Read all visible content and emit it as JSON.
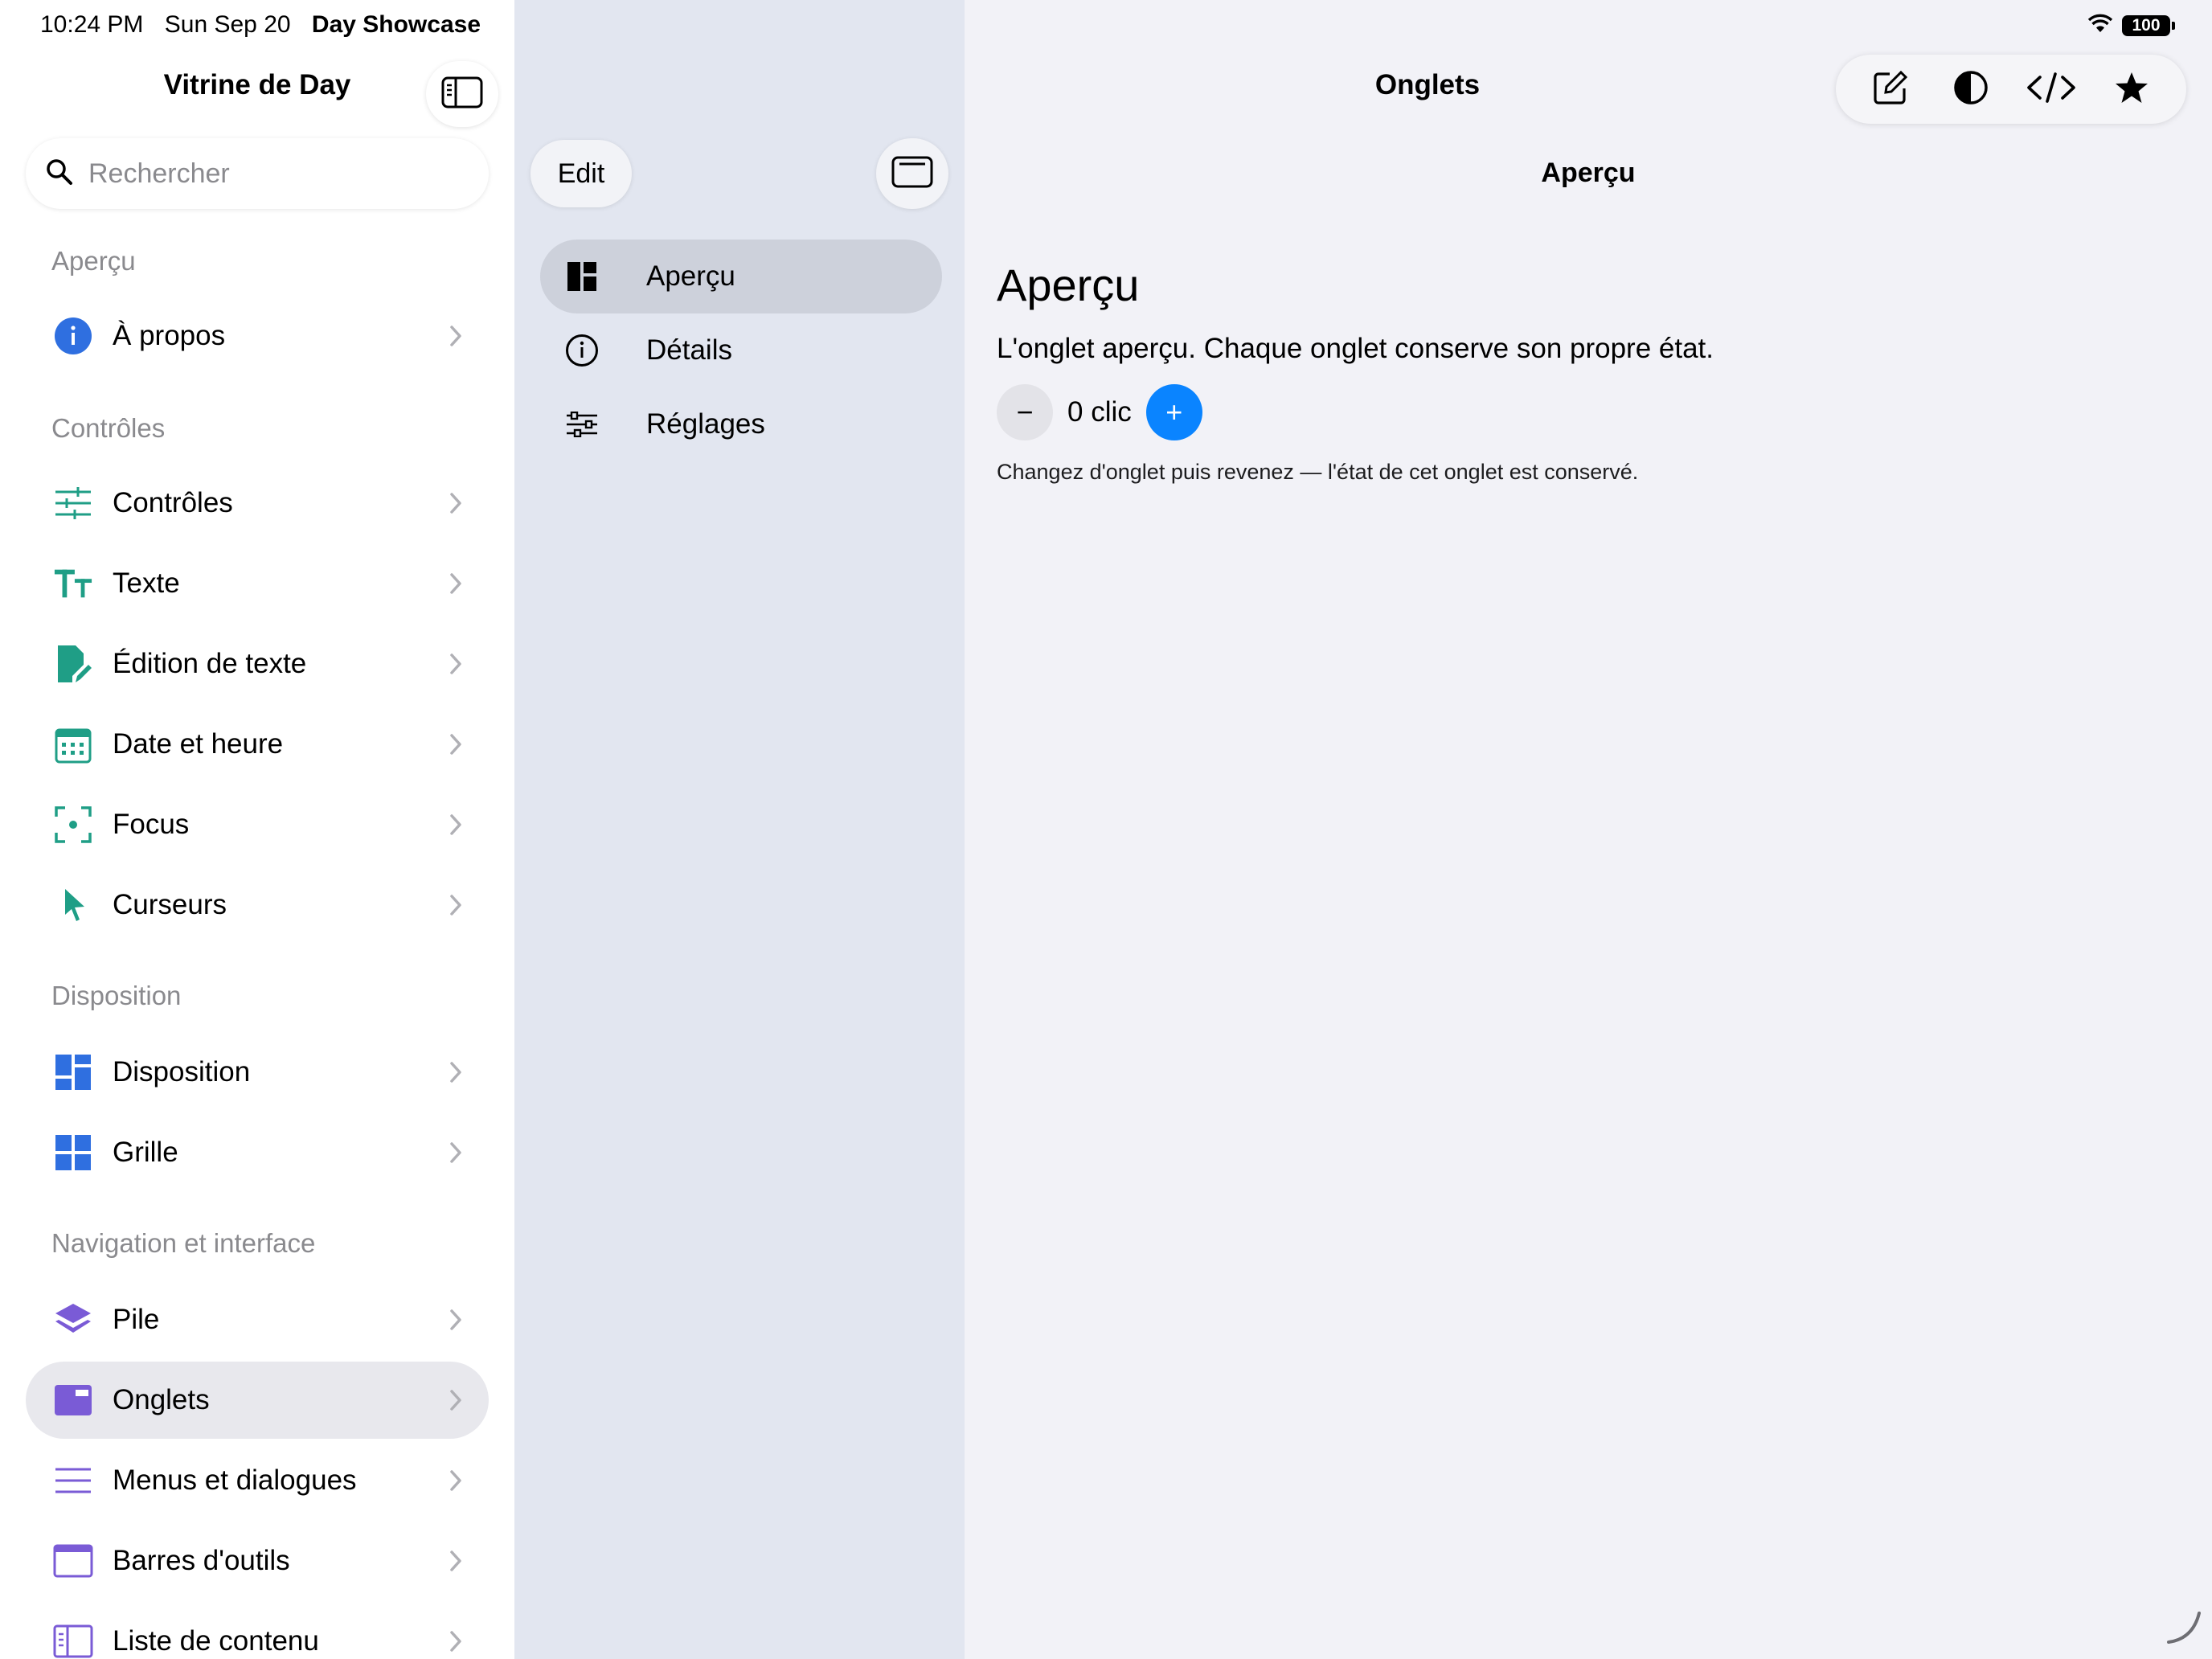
{
  "status_bar": {
    "time": "10:24 PM",
    "date": "Sun Sep 20",
    "app_name": "Day Showcase",
    "battery": "100"
  },
  "sidebar": {
    "title": "Vitrine de Day",
    "search_placeholder": "Rechercher",
    "sections": {
      "apercu": "Aperçu",
      "controles": "Contrôles",
      "disposition": "Disposition",
      "navigation": "Navigation et interface"
    },
    "items": {
      "a_propos": "À propos",
      "controles": "Contrôles",
      "texte": "Texte",
      "edition_texte": "Édition de texte",
      "date_heure": "Date et heure",
      "focus": "Focus",
      "curseurs": "Curseurs",
      "disposition": "Disposition",
      "grille": "Grille",
      "pile": "Pile",
      "onglets": "Onglets",
      "menus_dialogues": "Menus et dialogues",
      "barres_outils": "Barres d'outils",
      "liste_contenu": "Liste de contenu"
    },
    "selected": "onglets"
  },
  "middle": {
    "edit_label": "Edit",
    "tabs": {
      "apercu": "Aperçu",
      "details": "Détails",
      "reglages": "Réglages"
    },
    "selected": "apercu"
  },
  "content": {
    "nav_title": "Onglets",
    "subtitle": "Aperçu",
    "heading": "Aperçu",
    "description": "L'onglet aperçu. Chaque onglet conserve son propre état.",
    "counter_text": "0 clic",
    "minus_label": "−",
    "plus_label": "+",
    "hint": "Changez d'onglet puis revenez — l'état de cet onglet est conservé."
  },
  "colors": {
    "accent_blue": "#0a84ff",
    "teal": "#1f9e86",
    "blue_icon": "#2f6fe0",
    "purple_icon": "#7a5bd6"
  }
}
